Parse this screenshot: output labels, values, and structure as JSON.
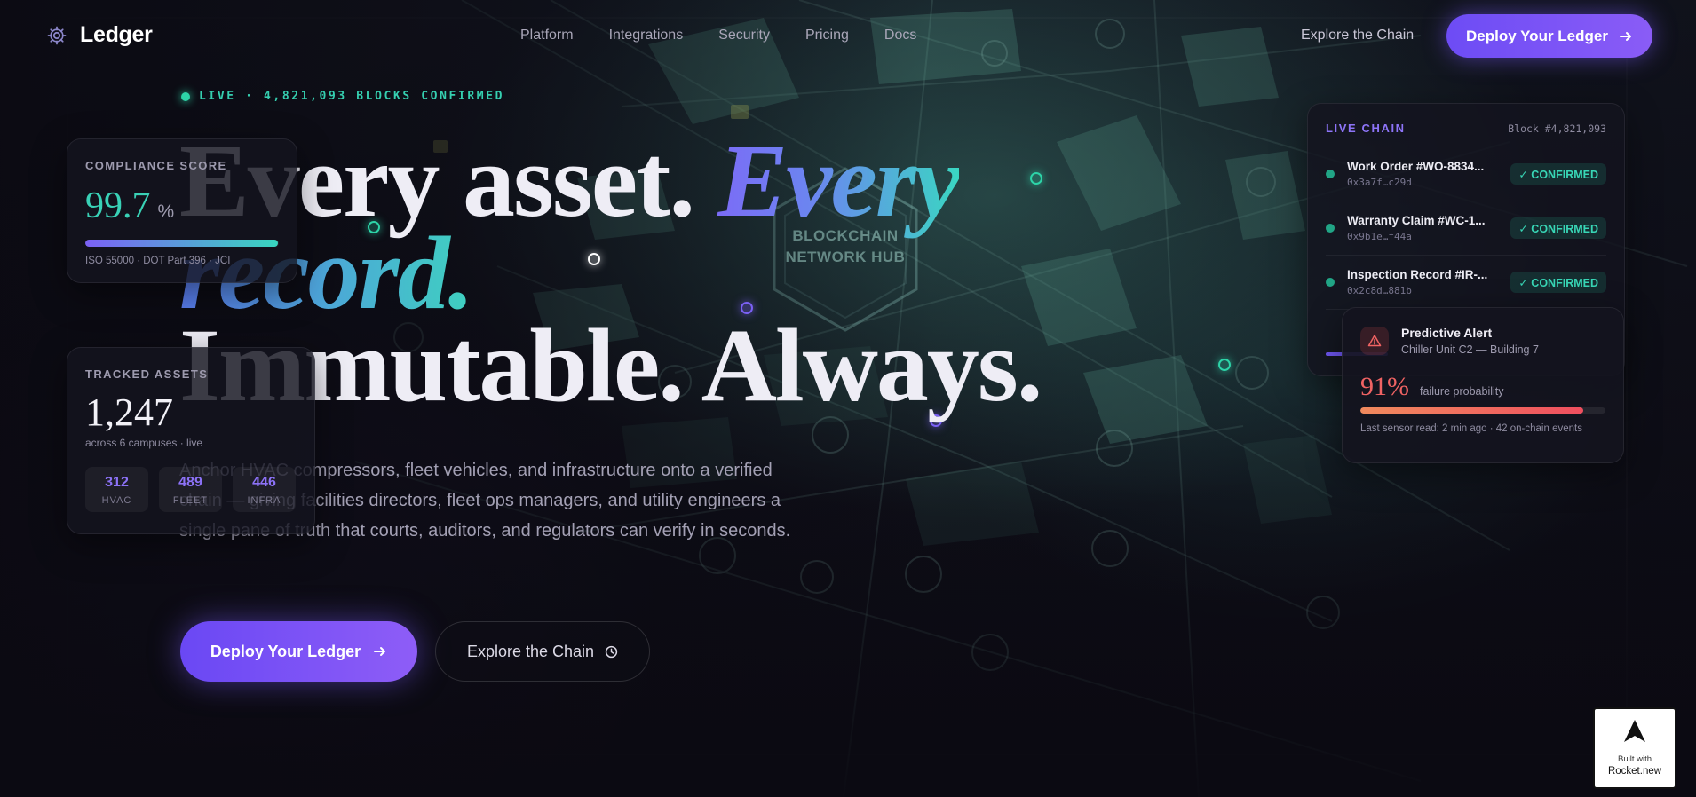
{
  "brand": {
    "name": "Ledger",
    "icon": "gear-icon"
  },
  "nav": {
    "links": [
      "Platform",
      "Integrations",
      "Security",
      "Pricing",
      "Docs"
    ],
    "explore": "Explore the Chain",
    "deploy": "Deploy Your Ledger"
  },
  "map": {
    "hub": "BLOCKCHAIN NETWORK HUB"
  },
  "hero": {
    "live": "LIVE · 4,821,093 BLOCKS CONFIRMED",
    "line1_plain": "Every asset. ",
    "line1_em": "Every",
    "line2_em": "record.",
    "line3": "Immutable. Always.",
    "description": "Anchor HVAC compressors, fleet vehicles, and infrastructure onto a verified chain — giving facilities directors, fleet ops managers, and utility engineers a single pane of truth that courts, auditors, and regulators can verify in seconds.",
    "cta_primary": "Deploy Your Ledger",
    "cta_secondary": "Explore the Chain"
  },
  "compliance": {
    "label": "COMPLIANCE SCORE",
    "value": "99.7",
    "unit": "%",
    "progress": 0.997,
    "standards": "ISO 55000 · DOT Part 396 · JCI"
  },
  "tracked": {
    "label": "TRACKED ASSETS",
    "value": "1,247",
    "sub": "across 6 campuses · live",
    "chips": [
      {
        "value": "312",
        "label": "HVAC"
      },
      {
        "value": "489",
        "label": "FLEET"
      },
      {
        "value": "446",
        "label": "INFRA"
      }
    ]
  },
  "chain": {
    "title": "LIVE CHAIN",
    "block": "Block #4,821,093",
    "rows": [
      {
        "title": "Work Order #WO-8834...",
        "hash": "0x3a7f…c29d",
        "status": "✓ CONFIRMED"
      },
      {
        "title": "Warranty Claim #WC-1...",
        "hash": "0x9b1e…f44a",
        "status": "✓ CONFIRMED"
      },
      {
        "title": "Inspection Record #IR-...",
        "hash": "0x2c8d…881b",
        "status": "✓ CONFIRMED"
      }
    ]
  },
  "alert": {
    "title": "Predictive Alert",
    "subtitle": "Chiller Unit C2 — Building 7",
    "percent": "91%",
    "percent_label": "failure probability",
    "progress": 0.91,
    "footer": "Last sensor read: 2 min ago · 42 on-chain events"
  },
  "badge": {
    "line1": "Built with",
    "line2": "Rocket.new"
  },
  "colors": {
    "accent": "#6d4cf5",
    "teal": "#2dd4a8",
    "alert": "#ef4f5f"
  }
}
